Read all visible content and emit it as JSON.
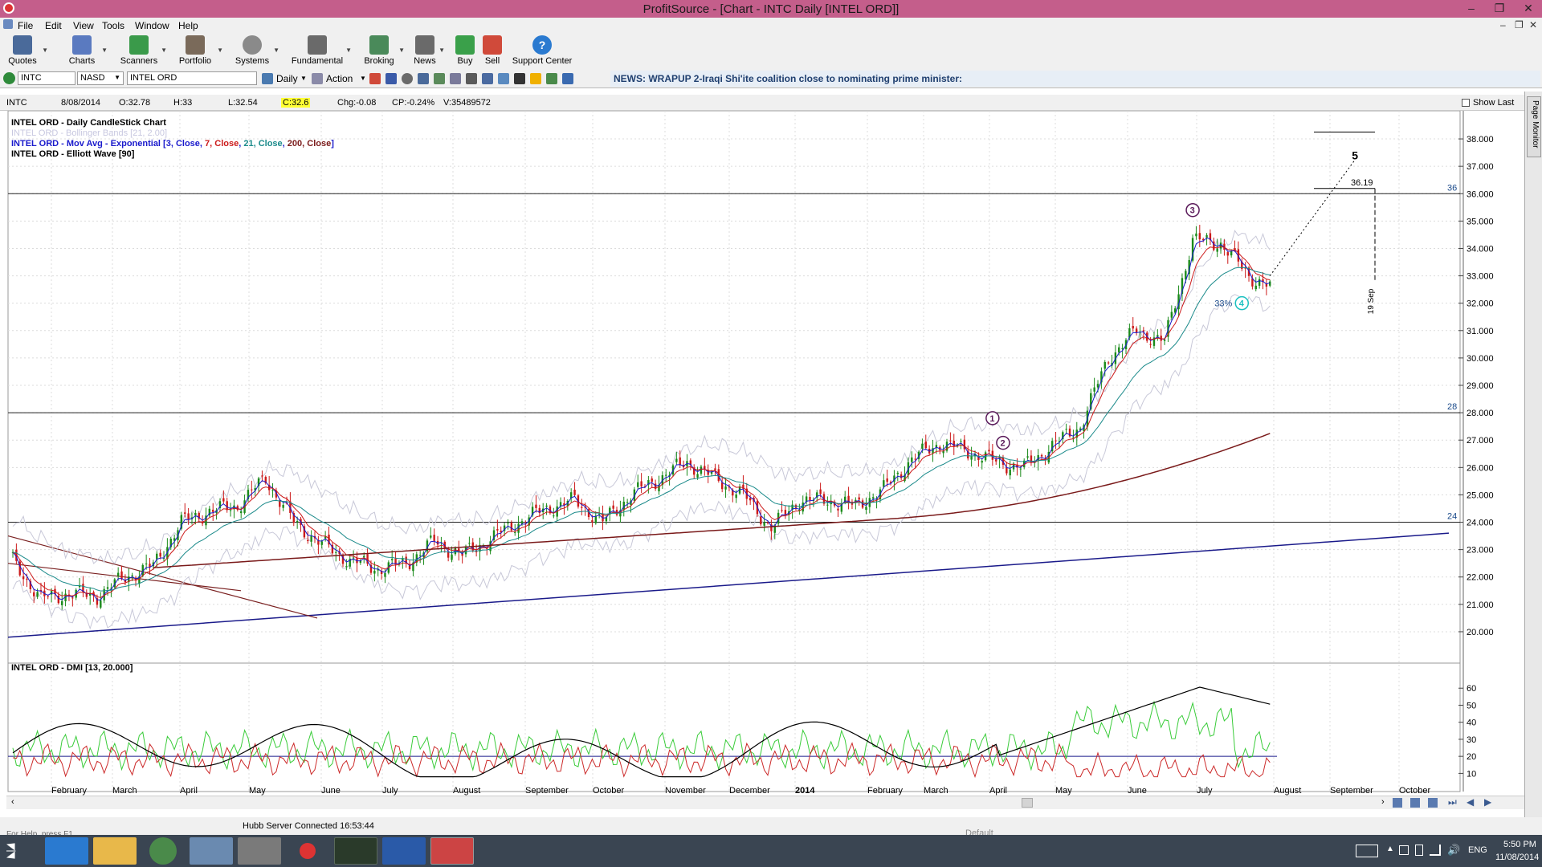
{
  "window": {
    "title": "ProfitSource - [Chart - INTC Daily [INTEL ORD]]",
    "min": "–",
    "max": "❐",
    "close": "✕",
    "mdi_min": "–",
    "mdi_restore": "❐",
    "mdi_close": "✕"
  },
  "menu": [
    "File",
    "Edit",
    "View",
    "Tools",
    "Window",
    "Help"
  ],
  "toolbar": [
    {
      "label": "Quotes",
      "icon": "quotes-icon",
      "color": "#4a6a9a"
    },
    {
      "label": "Charts",
      "icon": "charts-icon",
      "color": "#5a7ac0"
    },
    {
      "label": "Scanners",
      "icon": "scanners-icon",
      "color": "#3a9a4a"
    },
    {
      "label": "Portfolio",
      "icon": "portfolio-icon",
      "color": "#7a6a5a"
    },
    {
      "label": "Systems",
      "icon": "systems-icon",
      "color": "#8a8a8a"
    },
    {
      "label": "Fundamental",
      "icon": "fundamental-icon",
      "color": "#6a6a6a"
    },
    {
      "label": "Broking",
      "icon": "broking-icon",
      "color": "#4a8a5a"
    },
    {
      "label": "News",
      "icon": "news-icon",
      "color": "#6a6a6a"
    },
    {
      "label": "Buy",
      "icon": "buy-icon",
      "color": "#3aa04a"
    },
    {
      "label": "Sell",
      "icon": "sell-icon",
      "color": "#d04a3a"
    },
    {
      "label": "Support Center",
      "icon": "help-icon",
      "color": "#2a7ad0"
    }
  ],
  "symbol_bar": {
    "symbol": "INTC",
    "exchange": "NASD",
    "name": "INTEL ORD",
    "period": "Daily",
    "action": "Action",
    "news": "NEWS: WRAPUP 2-Iraqi Shi'ite coalition close to nominating prime minister:"
  },
  "info": {
    "symbol": "INTC",
    "date": "8/08/2014",
    "open": "O:32.78",
    "high": "H:33",
    "low": "L:32.54",
    "close": "C:32.6",
    "chg": "Chg:-0.08",
    "cp": "CP:-0.24%",
    "volume": "V:35489572",
    "show_last": "Show Last"
  },
  "legend": {
    "line1": "INTEL ORD - Daily CandleStick Chart",
    "line2": "INTEL ORD - Bollinger Bands [21, 2.00]",
    "ma_prefix": "INTEL ORD - Mov Avg - Exponential [",
    "ma_parts": [
      {
        "t": "3, Close",
        "c": "#1a1acc"
      },
      {
        "t": ", ",
        "c": "#1a1acc"
      },
      {
        "t": "7, Close",
        "c": "#cc1a1a"
      },
      {
        "t": ", ",
        "c": "#1a1acc"
      },
      {
        "t": "21, Close",
        "c": "#1a8a8a"
      },
      {
        "t": ", ",
        "c": "#1a1acc"
      },
      {
        "t": "200, Close",
        "c": "#7a1a1a"
      },
      {
        "t": "]",
        "c": "#1a1acc"
      }
    ],
    "line4": "INTEL ORD - Elliott Wave [90]",
    "dmi": "INTEL ORD - DMI [13, 20.000]"
  },
  "side_tab": "Page Monitor",
  "chart_data": {
    "type": "candlestick",
    "symbol": "INTC",
    "ylim": [
      19.5,
      38.5
    ],
    "y_ticks": [
      "38.000",
      "37.000",
      "36.000",
      "35.000",
      "34.000",
      "33.000",
      "32.000",
      "31.000",
      "30.000",
      "29.000",
      "28.000",
      "27.000",
      "26.000",
      "25.000",
      "24.000",
      "23.000",
      "22.000",
      "21.000",
      "20.000"
    ],
    "x_labels": [
      "February",
      "March",
      "April",
      "May",
      "June",
      "July",
      "August",
      "September",
      "October",
      "November",
      "December",
      "2014",
      "February",
      "March",
      "April",
      "May",
      "June",
      "July",
      "August",
      "September",
      "October"
    ],
    "close_path": [
      [
        0,
        22.6
      ],
      [
        8,
        21.2
      ],
      [
        16,
        21.4
      ],
      [
        24,
        21.3
      ],
      [
        32,
        22.0
      ],
      [
        40,
        22.4
      ],
      [
        48,
        24.0
      ],
      [
        56,
        24.4
      ],
      [
        64,
        24.6
      ],
      [
        72,
        25.6
      ],
      [
        80,
        24.0
      ],
      [
        88,
        23.2
      ],
      [
        96,
        22.6
      ],
      [
        104,
        22.3
      ],
      [
        112,
        22.5
      ],
      [
        120,
        23.3
      ],
      [
        128,
        22.8
      ],
      [
        136,
        23.4
      ],
      [
        144,
        24.0
      ],
      [
        152,
        24.5
      ],
      [
        160,
        24.8
      ],
      [
        168,
        24.0
      ],
      [
        176,
        25.0
      ],
      [
        184,
        25.6
      ],
      [
        192,
        26.2
      ],
      [
        200,
        25.6
      ],
      [
        208,
        25.0
      ],
      [
        216,
        23.8
      ],
      [
        224,
        24.8
      ],
      [
        232,
        24.8
      ],
      [
        240,
        24.6
      ],
      [
        248,
        25.2
      ],
      [
        256,
        26.3
      ],
      [
        264,
        26.9
      ],
      [
        272,
        26.6
      ],
      [
        280,
        26.2
      ],
      [
        288,
        26.0
      ],
      [
        296,
        26.8
      ],
      [
        304,
        27.5
      ],
      [
        312,
        30.0
      ],
      [
        320,
        31.0
      ],
      [
        328,
        30.6
      ],
      [
        336,
        34.3
      ],
      [
        344,
        34.2
      ],
      [
        352,
        33.0
      ],
      [
        358,
        32.6
      ]
    ],
    "annotations": [
      {
        "label": "5",
        "note": "projected wave 5 target"
      },
      {
        "label": "36.19",
        "note": "target level"
      },
      {
        "label": "19 Sep",
        "note": "time target"
      },
      {
        "label": "33%",
        "note": "wave 4 retracement"
      }
    ],
    "elliott_waves": [
      "1",
      "2",
      "3",
      "4"
    ],
    "h_lines": [
      {
        "value": 36,
        "label": "36"
      },
      {
        "value": 28,
        "label": "28"
      },
      {
        "value": 24,
        "label": "24"
      }
    ],
    "dmi": {
      "title": "INTEL ORD - DMI [13, 20.000]",
      "ylim": [
        5,
        70
      ],
      "y_ticks": [
        "60",
        "50",
        "40",
        "30",
        "20",
        "10"
      ],
      "threshold": 20
    }
  },
  "status": {
    "help": "For Help, press F1",
    "server": "Hubb Server Connected 16:53:44",
    "mode": "Default"
  },
  "taskbar": {
    "lang": "ENG",
    "time": "5:50 PM",
    "date": "11/08/2014"
  }
}
